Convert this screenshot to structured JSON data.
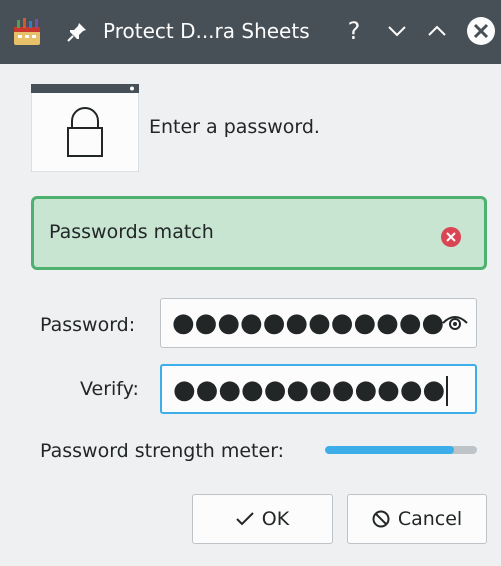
{
  "titlebar": {
    "title": "Protect D...ra Sheets",
    "help_label": "?"
  },
  "icons": {
    "app": "app-icon",
    "pin": "pin-icon",
    "minimize": "chevron-down-icon",
    "maximize": "chevron-up-icon",
    "close": "close-icon",
    "lock": "lock-icon",
    "error": "error-icon",
    "eye": "eye-icon",
    "check": "check-icon",
    "cancel": "cancel-icon"
  },
  "content": {
    "prompt": "Enter a password."
  },
  "banner": {
    "text": "Passwords match",
    "color": "#4fb170"
  },
  "fields": {
    "password_label": "Password:",
    "password_value": "●●●●●●●●●●●●",
    "verify_label": "Verify:",
    "verify_value": "●●●●●●●●●●●●"
  },
  "strength": {
    "label": "Password strength meter:",
    "level": 0.85,
    "color": "#3daee9"
  },
  "buttons": {
    "ok_label": "OK",
    "cancel_label": "Cancel"
  },
  "colors": {
    "titlebar": "#475057",
    "accent": "#3daee9",
    "background": "#eff0f1"
  }
}
